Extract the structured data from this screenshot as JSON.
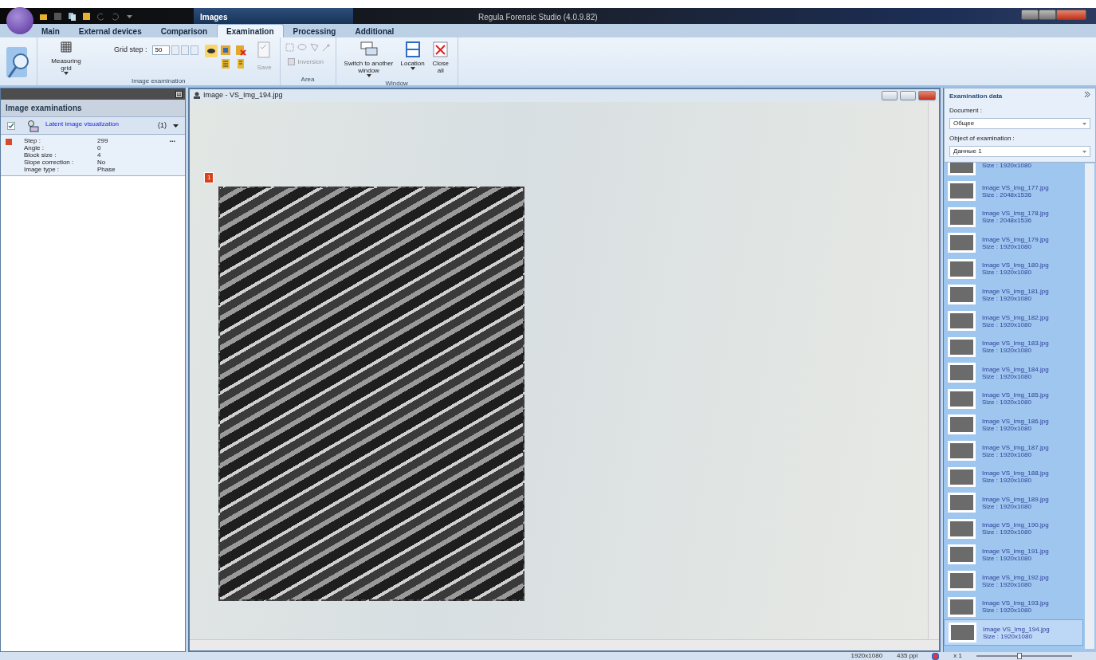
{
  "window": {
    "title": "Regula Forensic Studio (4.0.9.82)",
    "context_tab": "Images"
  },
  "tabs": [
    {
      "label": "Main",
      "selected": false
    },
    {
      "label": "External devices",
      "selected": false
    },
    {
      "label": "Comparison",
      "selected": false
    },
    {
      "label": "Examination",
      "selected": true
    },
    {
      "label": "Processing",
      "selected": false
    },
    {
      "label": "Additional",
      "selected": false
    }
  ],
  "ribbon": {
    "measuring_grid": "Measuring grid",
    "grid_step_label": "Grid step :",
    "grid_step": "50",
    "image_group": "Image examination",
    "save": {
      "label": "Save",
      "disabled": true
    },
    "inversion": {
      "label": "Inversion",
      "disabled": true
    },
    "area_group": "Area",
    "switch_window": "Switch to another window",
    "location": "Location",
    "close_all": "Close all",
    "window_group": "Window"
  },
  "left_panel": {
    "title": "Image examinations",
    "examinations": [
      {
        "name": "Latent image visualization",
        "checked": true,
        "count": "(1)",
        "more": "...",
        "params": [
          {
            "label": "Step :",
            "value": "299"
          },
          {
            "label": "Angle :",
            "value": "0"
          },
          {
            "label": "Block size :",
            "value": "4"
          },
          {
            "label": "Slope correction :",
            "value": "No"
          },
          {
            "label": "Image type :",
            "value": "Phase"
          }
        ]
      }
    ]
  },
  "image_window": {
    "title": "Image - VS_Img_194.jpg",
    "marker": "1"
  },
  "right_panel": {
    "title": "Examination data",
    "document_label": "Document :",
    "document": "Общее",
    "object_label": "Object of examination :",
    "object": "Данные 1",
    "images": [
      {
        "size": "Size : 1920x1080",
        "selected": false
      },
      {
        "name": "Image VS_Img_177.jpg",
        "size": "Size : 2048x1536",
        "selected": false
      },
      {
        "name": "Image VS_Img_178.jpg",
        "size": "Size : 2048x1536",
        "selected": false
      },
      {
        "name": "Image VS_Img_179.jpg",
        "size": "Size : 1920x1080",
        "selected": false
      },
      {
        "name": "Image VS_Img_180.jpg",
        "size": "Size : 1920x1080",
        "selected": false
      },
      {
        "name": "Image VS_Img_181.jpg",
        "size": "Size : 1920x1080",
        "selected": false
      },
      {
        "name": "Image VS_Img_182.jpg",
        "size": "Size : 1920x1080",
        "selected": false
      },
      {
        "name": "Image VS_Img_183.jpg",
        "size": "Size : 1920x1080",
        "selected": false
      },
      {
        "name": "Image VS_Img_184.jpg",
        "size": "Size : 1920x1080",
        "selected": false
      },
      {
        "name": "Image VS_Img_185.jpg",
        "size": "Size : 1920x1080",
        "selected": false
      },
      {
        "name": "Image VS_Img_186.jpg",
        "size": "Size : 1920x1080",
        "selected": false
      },
      {
        "name": "Image VS_Img_187.jpg",
        "size": "Size : 1920x1080",
        "selected": false
      },
      {
        "name": "Image VS_Img_188.jpg",
        "size": "Size : 1920x1080",
        "selected": false
      },
      {
        "name": "Image VS_Img_189.jpg",
        "size": "Size : 1920x1080",
        "selected": false
      },
      {
        "name": "Image VS_Img_190.jpg",
        "size": "Size : 1920x1080",
        "selected": false
      },
      {
        "name": "Image VS_Img_191.jpg",
        "size": "Size : 1920x1080",
        "selected": false
      },
      {
        "name": "Image VS_Img_192.jpg",
        "size": "Size : 1920x1080",
        "selected": false
      },
      {
        "name": "Image VS_Img_193.jpg",
        "size": "Size : 1920x1080",
        "selected": false
      },
      {
        "name": "Image VS_Img_194.jpg",
        "size": "Size : 1920x1080",
        "selected": true
      }
    ]
  },
  "status_bar": {
    "resolution": "1920x1080",
    "ppi": "435 ppi",
    "zoom": "x 1",
    "zoom_slider": {
      "level": 0.45
    }
  }
}
